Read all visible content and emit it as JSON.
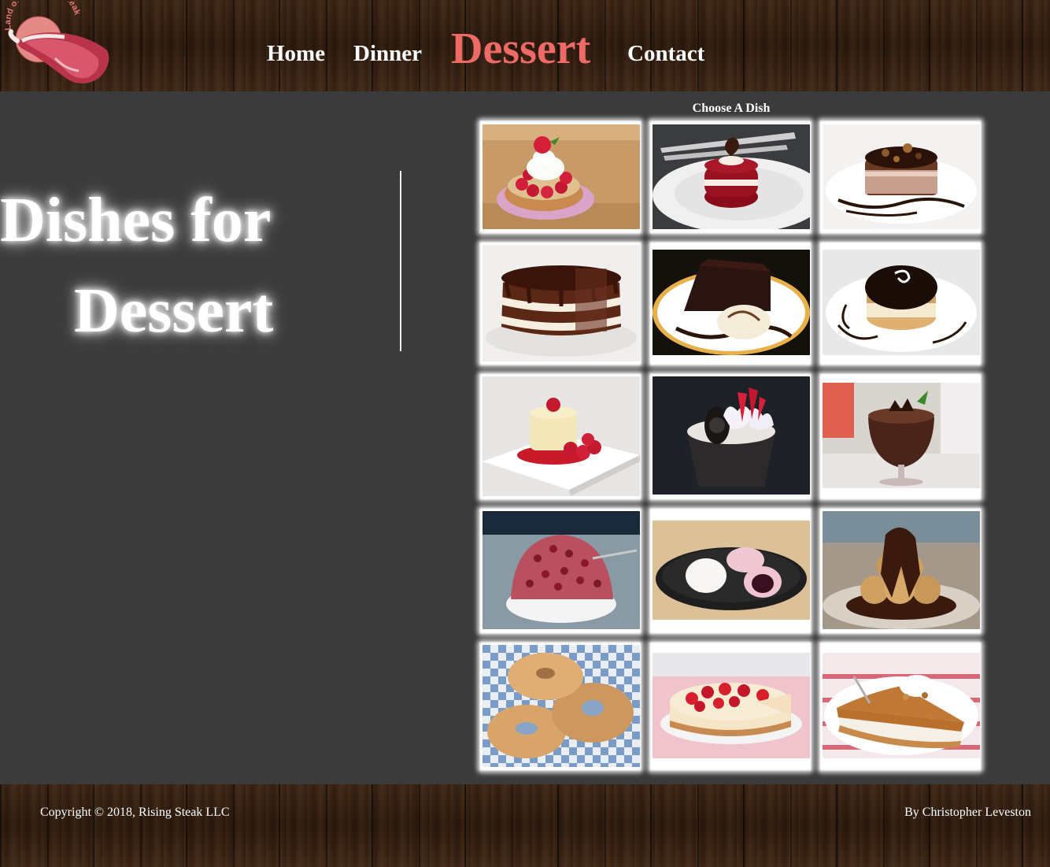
{
  "header": {
    "logo_text": "Land of the Rising Steak",
    "nav": {
      "home": "Home",
      "dinner": "Dinner",
      "dessert": "Dessert",
      "contact": "Contact"
    },
    "active_color": "#ee6a64"
  },
  "hero": {
    "line1": "Dishes for",
    "line2": "Dessert"
  },
  "gallery": {
    "title": "Choose A Dish",
    "dishes": [
      "raspberry-cream-tart",
      "red-velvet-mini-cake",
      "chocolate-mousse-cake",
      "layered-chocolate-cake",
      "chocolate-lava-cake-slice",
      "boston-cream-pie",
      "raspberry-panna-cotta",
      "cookies-and-cream-ice-cream",
      "chocolate-mousse-glass",
      "red-bean-shaved-ice",
      "mochi",
      "profiteroles",
      "sugared-donuts",
      "strawberry-cheesecake",
      "pumpkin-pie"
    ]
  },
  "footer": {
    "copyright": "Copyright © 2018, Rising Steak LLC",
    "author": "By Christopher Leveston"
  }
}
